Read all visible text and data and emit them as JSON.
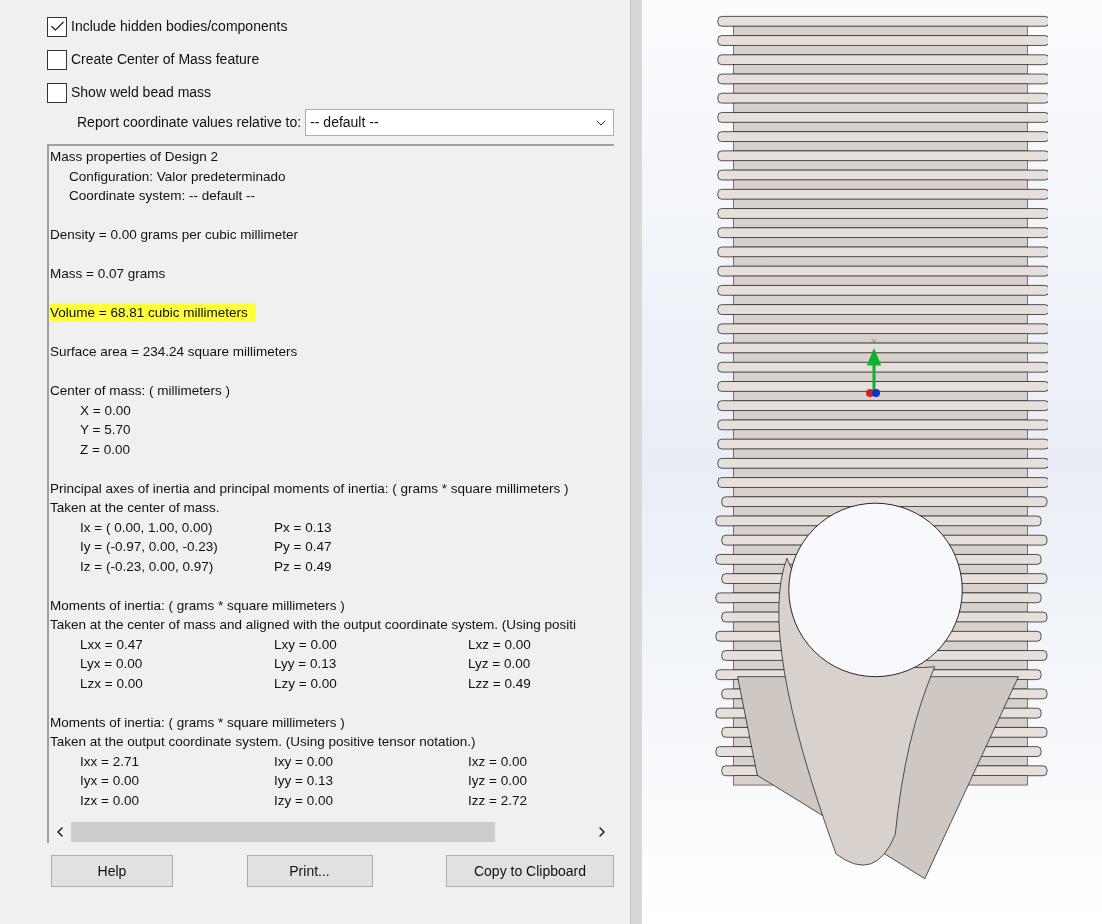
{
  "options": [
    {
      "label": "Include hidden bodies/components",
      "checked": true
    },
    {
      "label": "Create Center of Mass feature",
      "checked": false
    },
    {
      "label": "Show weld bead mass",
      "checked": false
    }
  ],
  "coordinate_select": {
    "label": "Report coordinate values relative to:",
    "value": "-- default --"
  },
  "report": {
    "sections": [
      [
        {
          "kind": "text",
          "text": "Mass properties of Design 2"
        },
        {
          "kind": "sub",
          "text": "Configuration: Valor predeterminado"
        },
        {
          "kind": "sub",
          "text": "Coordinate system: -- default --"
        }
      ],
      [
        {
          "kind": "text",
          "text": "Density = 0.00 grams per cubic millimeter"
        }
      ],
      [
        {
          "kind": "text",
          "text": "Mass = 0.07 grams"
        }
      ],
      [
        {
          "kind": "highlight",
          "text": "Volume = 68.81 cubic millimeters"
        }
      ],
      [
        {
          "kind": "text",
          "text": "Surface area = 234.24  square millimeters"
        }
      ],
      [
        {
          "kind": "text",
          "text": "Center of mass: ( millimeters )"
        },
        {
          "kind": "value",
          "text": "X = 0.00"
        },
        {
          "kind": "value",
          "text": "Y = 5.70"
        },
        {
          "kind": "value",
          "text": "Z = 0.00"
        }
      ],
      [
        {
          "kind": "text",
          "text": "Principal axes of inertia and principal moments of inertia: ( grams *  square millimeters )"
        },
        {
          "kind": "text",
          "text": "Taken at the center of mass."
        },
        {
          "kind": "columns",
          "cells": [
            "Ix = ( 0.00,  1.00,  0.00)",
            "Px = 0.13"
          ]
        },
        {
          "kind": "columns",
          "cells": [
            "Iy = (-0.97,  0.00, -0.23)",
            "Py = 0.47"
          ]
        },
        {
          "kind": "columns",
          "cells": [
            "Iz = (-0.23,  0.00,  0.97)",
            "Pz = 0.49"
          ]
        }
      ],
      [
        {
          "kind": "text",
          "text": "Moments of inertia: ( grams *  square millimeters )"
        },
        {
          "kind": "text",
          "text": "Taken at the center of mass and aligned with the output coordinate system. (Using positi"
        },
        {
          "kind": "columns",
          "cells": [
            "Lxx = 0.47",
            "Lxy = 0.00",
            "Lxz = 0.00"
          ]
        },
        {
          "kind": "columns",
          "cells": [
            "Lyx = 0.00",
            "Lyy = 0.13",
            "Lyz = 0.00"
          ]
        },
        {
          "kind": "columns",
          "cells": [
            "Lzx = 0.00",
            "Lzy = 0.00",
            "Lzz = 0.49"
          ]
        }
      ],
      [
        {
          "kind": "text",
          "text": "Moments of inertia: ( grams *  square millimeters )"
        },
        {
          "kind": "text",
          "text": "Taken at the output coordinate system. (Using positive tensor notation.)"
        },
        {
          "kind": "columns",
          "cells": [
            "Ixx = 2.71",
            "Ixy = 0.00",
            "Ixz = 0.00"
          ]
        },
        {
          "kind": "columns",
          "cells": [
            "Iyx = 0.00",
            "Iyy = 0.13",
            "Iyz = 0.00"
          ]
        },
        {
          "kind": "columns",
          "cells": [
            "Izx = 0.00",
            "Izy = 0.00",
            "Izz = 2.72"
          ]
        }
      ]
    ]
  },
  "buttons": [
    "Help",
    "Print...",
    "Copy to Clipboard"
  ],
  "viewport": {
    "axis_label": "Y"
  }
}
